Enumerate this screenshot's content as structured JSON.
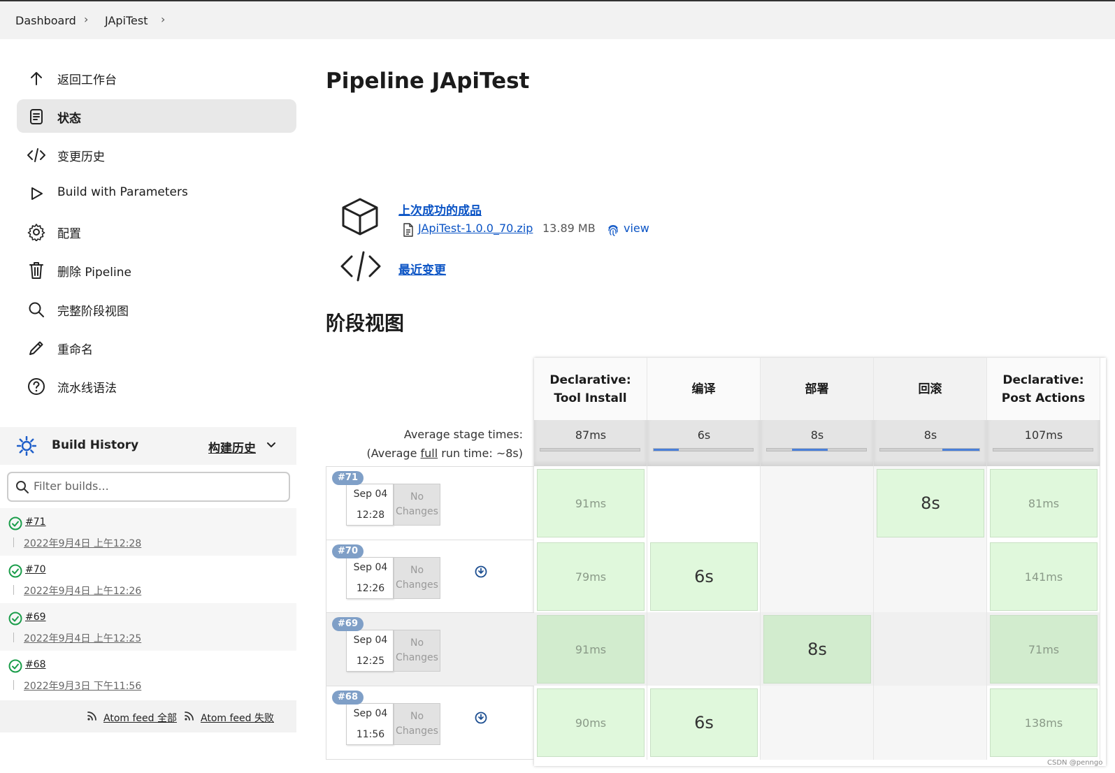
{
  "breadcrumb": {
    "items": [
      "Dashboard",
      "JApiTest"
    ]
  },
  "sidebar": {
    "items": [
      {
        "label": "返回工作台",
        "icon": "arrow-up-icon"
      },
      {
        "label": "状态",
        "icon": "document-icon",
        "active": true
      },
      {
        "label": "变更历史",
        "icon": "code-icon"
      },
      {
        "label": "Build with Parameters",
        "icon": "play-icon"
      },
      {
        "label": "配置",
        "icon": "gear-icon"
      },
      {
        "label": "删除 Pipeline",
        "icon": "trash-icon"
      },
      {
        "label": "完整阶段视图",
        "icon": "search-icon"
      },
      {
        "label": "重命名",
        "icon": "pencil-icon"
      },
      {
        "label": "流水线语法",
        "icon": "help-icon"
      }
    ]
  },
  "build_history": {
    "title": "Build History",
    "trend": "构建历史",
    "filter_placeholder": "Filter builds...",
    "builds": [
      {
        "number": "#71",
        "date": "2022年9月4日 上午12:28"
      },
      {
        "number": "#70",
        "date": "2022年9月4日 上午12:26"
      },
      {
        "number": "#69",
        "date": "2022年9月4日 上午12:25"
      },
      {
        "number": "#68",
        "date": "2022年9月3日 下午11:56"
      }
    ],
    "feed_all": "Atom feed 全部",
    "feed_fail": "Atom feed 失败"
  },
  "main": {
    "title": "Pipeline JApiTest",
    "last_success_label": "上次成功的成品",
    "artifact_file": "JApiTest-1.0.0_70.zip",
    "artifact_size": "13.89 MB",
    "artifact_view": "view",
    "recent_changes": "最近变更",
    "stage_view_title": "阶段视图"
  },
  "stage_view": {
    "avg_label": "Average stage times:",
    "avg_full_prefix": "(Average ",
    "avg_full_word": "full",
    "avg_full_suffix": " run time: ~8s)",
    "stages": [
      {
        "name_line1": "Declarative:",
        "name_line2": "Tool Install",
        "avg": "87ms",
        "bar_start": 0,
        "bar_fraction": 0
      },
      {
        "name_line1": "编译",
        "name_line2": "",
        "avg": "6s",
        "bar_start": 0,
        "bar_fraction": 0.25
      },
      {
        "name_line1": "部署",
        "name_line2": "",
        "avg": "8s",
        "bar_start": 0.25,
        "bar_fraction": 0.36
      },
      {
        "name_line1": "回滚",
        "name_line2": "",
        "avg": "8s",
        "bar_start": 0.63,
        "bar_fraction": 0.37
      },
      {
        "name_line1": "Declarative:",
        "name_line2": "Post Actions",
        "avg": "107ms",
        "bar_start": 0,
        "bar_fraction": 0
      }
    ],
    "runs": [
      {
        "badge": "#71",
        "date": "Sep 04",
        "time": "12:28",
        "changes_line1": "No",
        "changes_line2": "Changes",
        "has_download": false,
        "cells": [
          "91ms",
          "",
          "",
          "8s",
          "81ms"
        ]
      },
      {
        "badge": "#70",
        "date": "Sep 04",
        "time": "12:26",
        "changes_line1": "No",
        "changes_line2": "Changes",
        "has_download": true,
        "cells": [
          "79ms",
          "6s",
          "",
          "",
          "141ms"
        ]
      },
      {
        "badge": "#69",
        "date": "Sep 04",
        "time": "12:25",
        "changes_line1": "No",
        "changes_line2": "Changes",
        "has_download": false,
        "cells": [
          "91ms",
          "",
          "8s",
          "",
          "71ms"
        ]
      },
      {
        "badge": "#68",
        "date": "Sep 04",
        "time": "11:56",
        "changes_line1": "No",
        "changes_line2": "Changes",
        "has_download": true,
        "cells": [
          "90ms",
          "6s",
          "",
          "",
          "138ms"
        ]
      }
    ]
  },
  "watermark": "CSDN @penngo",
  "colors": {
    "link": "#0b54c5",
    "success_cell": "#e0f8dc",
    "badge": "#7f9fc7",
    "success_icon": "#1a9d4a"
  }
}
